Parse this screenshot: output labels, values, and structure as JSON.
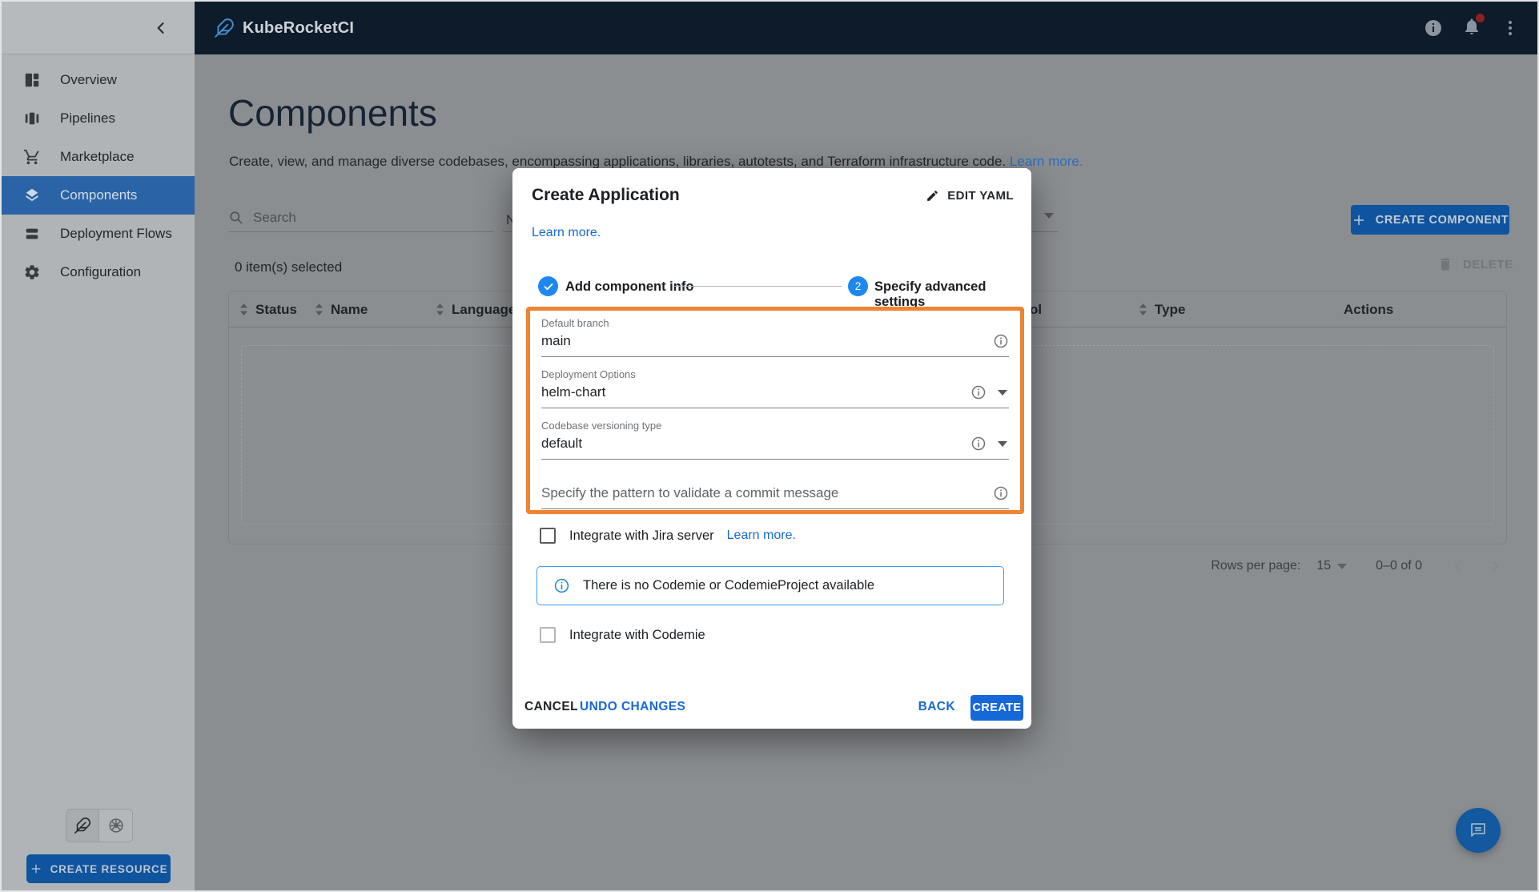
{
  "colors": {
    "topbar_bg": "#0e1b2a",
    "selected_nav_bg": "#2a63a6",
    "accent_blue": "#1668d9",
    "stepper_blue": "#1e88f0",
    "highlight_orange": "#ef8432",
    "alert_blue": "#3ba0f2",
    "dimmed_button_bg": "#0f549f",
    "fab_bg": "#12599f",
    "backdrop_gray": "#8b8e91"
  },
  "topbar": {
    "app_title": "KubeRocketCI"
  },
  "sidebar": {
    "items": [
      {
        "label": "Overview"
      },
      {
        "label": "Pipelines"
      },
      {
        "label": "Marketplace"
      },
      {
        "label": "Components"
      },
      {
        "label": "Deployment Flows"
      },
      {
        "label": "Configuration"
      }
    ],
    "create_resource_label": "CREATE RESOURCE"
  },
  "page": {
    "title": "Components",
    "description": "Create, view, and manage diverse codebases, encompassing applications, libraries, autotests, and Terraform infrastructure code.",
    "learn_more_label": "Learn more.",
    "search_placeholder": "Search",
    "filter_partial_text": "N",
    "create_component_label": "CREATE COMPONENT",
    "selected_count": "0 item(s) selected",
    "delete_label": "DELETE",
    "table_headers": {
      "status": "Status",
      "name": "Name",
      "language": "Language",
      "partial": "ol",
      "type": "Type",
      "actions": "Actions"
    },
    "pagination": {
      "rows_per_page_label": "Rows per page:",
      "rows_per_page_value": "15",
      "range_label": "0–0 of 0"
    }
  },
  "modal": {
    "title": "Create Application",
    "edit_yaml_label": "EDIT YAML",
    "learn_more_label": "Learn more.",
    "stepper": {
      "step1_label": "Add component info",
      "step2_number": "2",
      "step2_label": "Specify advanced settings"
    },
    "fields": {
      "default_branch": {
        "label": "Default branch",
        "value": "main"
      },
      "deployment_options": {
        "label": "Deployment Options",
        "value": "helm-chart"
      },
      "versioning_type": {
        "label": "Codebase versioning type",
        "value": "default"
      },
      "commit_pattern": {
        "placeholder": "Specify the pattern to validate a commit message"
      }
    },
    "jira": {
      "checkbox_label": "Integrate with Jira server",
      "learn_more_label": "Learn more."
    },
    "codemie_alert": "There is no Codemie or CodemieProject available",
    "codemie_checkbox_label": "Integrate with Codemie",
    "footer": {
      "cancel": "CANCEL",
      "undo": "UNDO CHANGES",
      "back": "BACK",
      "create": "CREATE"
    }
  }
}
